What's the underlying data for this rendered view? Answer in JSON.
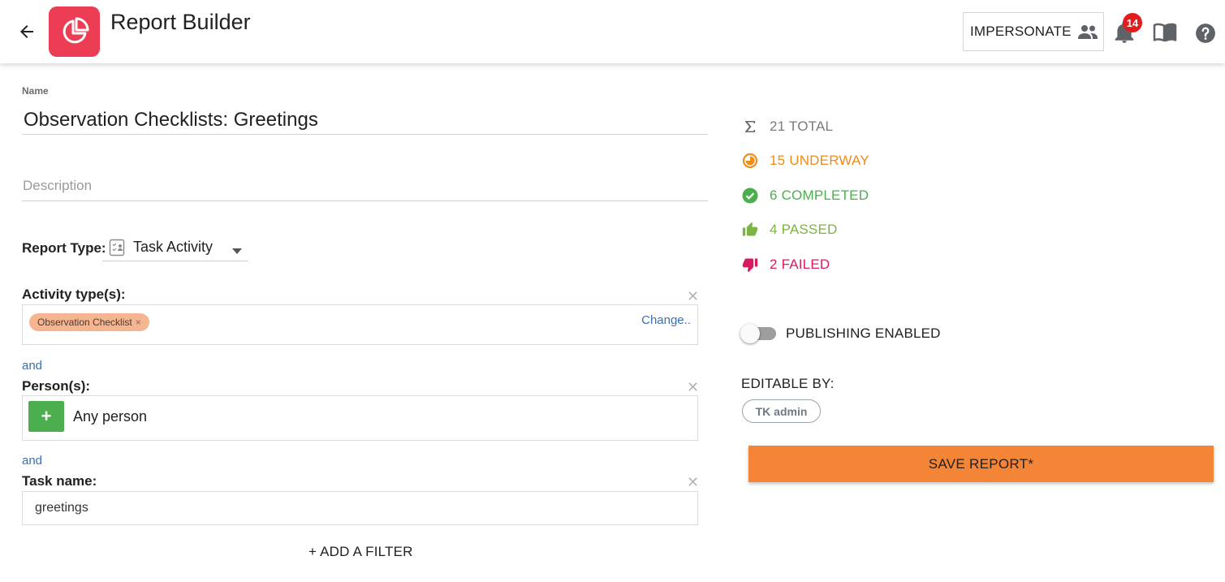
{
  "app": {
    "title": "Report Builder",
    "logo_color": "#ec3d54"
  },
  "header": {
    "impersonate_label": "IMPERSONATE",
    "notification_count": "14"
  },
  "form": {
    "name_label": "Name",
    "name_value": "Observation Checklists: Greetings",
    "description_placeholder": "Description",
    "report_type_label": "Report Type:",
    "report_type_value": "Task Activity",
    "filters": {
      "activity": {
        "label": "Activity type(s):",
        "chip": "Observation Checklist",
        "change_label": "Change.."
      },
      "and_1": "and",
      "person": {
        "label": "Person(s):",
        "value": "Any person"
      },
      "and_2": "and",
      "task": {
        "label": "Task name:",
        "value": "greetings"
      }
    },
    "add_filter_label": "+ ADD A FILTER"
  },
  "stats": {
    "total": "21 TOTAL",
    "underway": "15 UNDERWAY",
    "completed": "6 COMPLETED",
    "passed": "4 PASSED",
    "failed": "2 FAILED",
    "colors": {
      "total": "#7a7a7a",
      "underway": "#ef8c1a",
      "completed": "#4cae4f",
      "passed": "#7cb342",
      "failed": "#d81b60"
    }
  },
  "publishing": {
    "label": "PUBLISHING ENABLED",
    "enabled": false
  },
  "editable": {
    "label": "EDITABLE BY:",
    "editors": [
      "TK admin"
    ]
  },
  "save_label": "SAVE REPORT*",
  "accent_color": "#f48436"
}
